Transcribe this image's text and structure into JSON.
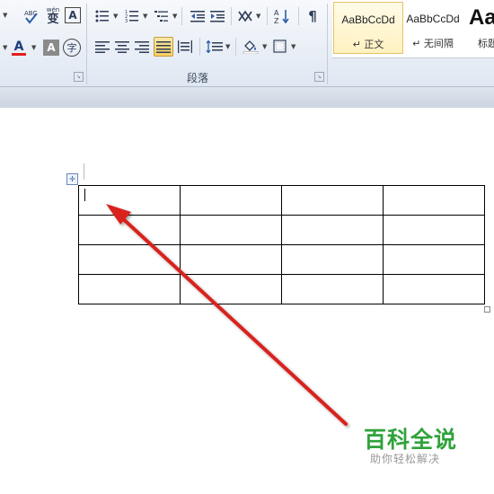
{
  "ribbon": {
    "paragraph_group_label": "段落",
    "font_color_glyph": "A",
    "shade_glyph": "A",
    "phonetic_glyph": "wén",
    "phonetic_top": "变",
    "sort_glyph": "A↓",
    "styles": [
      {
        "sample": "AaBbCcDd",
        "label": "↵ 正文",
        "selected": true
      },
      {
        "sample": "AaBbCcDd",
        "label": "↵ 无间隔",
        "selected": false
      },
      {
        "sample": "AaB",
        "label": "标题",
        "selected": false
      }
    ]
  },
  "table": {
    "rows": 4,
    "cols": 4
  },
  "colors": {
    "arrow": "#d9201f",
    "watermark_title": "#2fa33b",
    "watermark_sub": "#999999",
    "font_color_bar": "#e02020"
  },
  "watermark": {
    "title": "百科全说",
    "subtitle": "助你轻松解决"
  }
}
